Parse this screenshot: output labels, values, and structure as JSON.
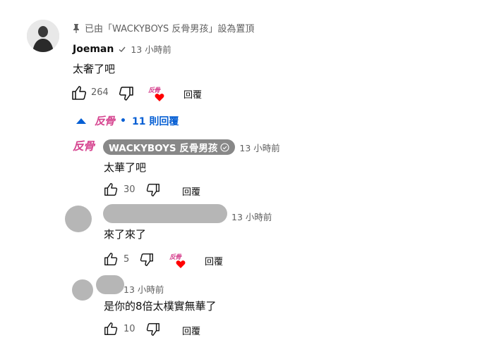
{
  "pinned": {
    "icon": "pin-icon",
    "text": "已由「WACKYBOYS 反骨男孩」設為置頂"
  },
  "top_comment": {
    "author": "Joeman",
    "verified": true,
    "time": "13 小時前",
    "text": "太奢了吧",
    "likes": "264",
    "reply_label": "回覆",
    "creator_heart": true
  },
  "replies_toggle": {
    "label": "11 則回覆"
  },
  "replies": [
    {
      "author": "WACKYBOYS 反骨男孩",
      "is_owner": true,
      "time": "13 小時前",
      "text": "太華了吧",
      "likes": "30",
      "reply_label": "回覆"
    },
    {
      "time": "13 小時前",
      "text": "來了來了",
      "likes": "5",
      "reply_label": "回覆",
      "creator_heart": true
    },
    {
      "time": "13 小時前",
      "text": "是你的8倍太樸實無華了",
      "likes": "10",
      "reply_label": "回覆"
    }
  ],
  "logo_text": "反骨",
  "colors": {
    "link_blue": "#065fd4",
    "heart_red": "#ff0000",
    "logo_pink": "#d64590",
    "owner_chip": "#888888"
  }
}
